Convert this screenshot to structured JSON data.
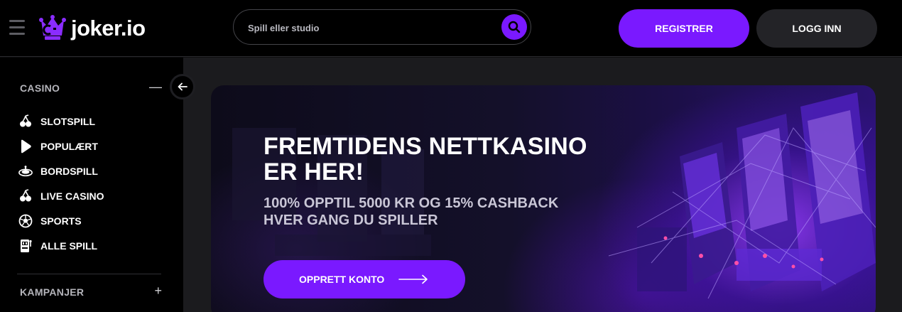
{
  "header": {
    "logo_text": "joker.io",
    "search_placeholder": "Spill eller studio",
    "register_label": "REGISTRER",
    "login_label": "LOGG INN"
  },
  "sidebar": {
    "casino_label": "CASINO",
    "casino_toggle": "—",
    "items": [
      {
        "label": "SLOTSPILL",
        "icon": "cherries-icon"
      },
      {
        "label": "POPULÆRT",
        "icon": "play-icon"
      },
      {
        "label": "BORDSPILL",
        "icon": "roulette-icon"
      },
      {
        "label": "LIVE CASINO",
        "icon": "cherries-icon"
      },
      {
        "label": "SPORTS",
        "icon": "soccer-ball-icon"
      },
      {
        "label": "ALLE SPILL",
        "icon": "slot-machine-icon"
      }
    ],
    "campaigns_label": "KAMPANJER",
    "campaigns_toggle": "+"
  },
  "banner": {
    "title_line1": "FREMTIDENS NETTKASINO",
    "title_line2": "ER HER!",
    "subtitle_line1": "100% OPPTIL 5000 KR OG 15% CASHBACK",
    "subtitle_line2": "HVER GANG DU SPILLER",
    "cta_label": "OPPRETT KONTO"
  },
  "colors": {
    "accent": "#7a19ff",
    "header_bg": "#000000",
    "main_bg": "#1b1b1e",
    "login_bg": "#232327"
  }
}
